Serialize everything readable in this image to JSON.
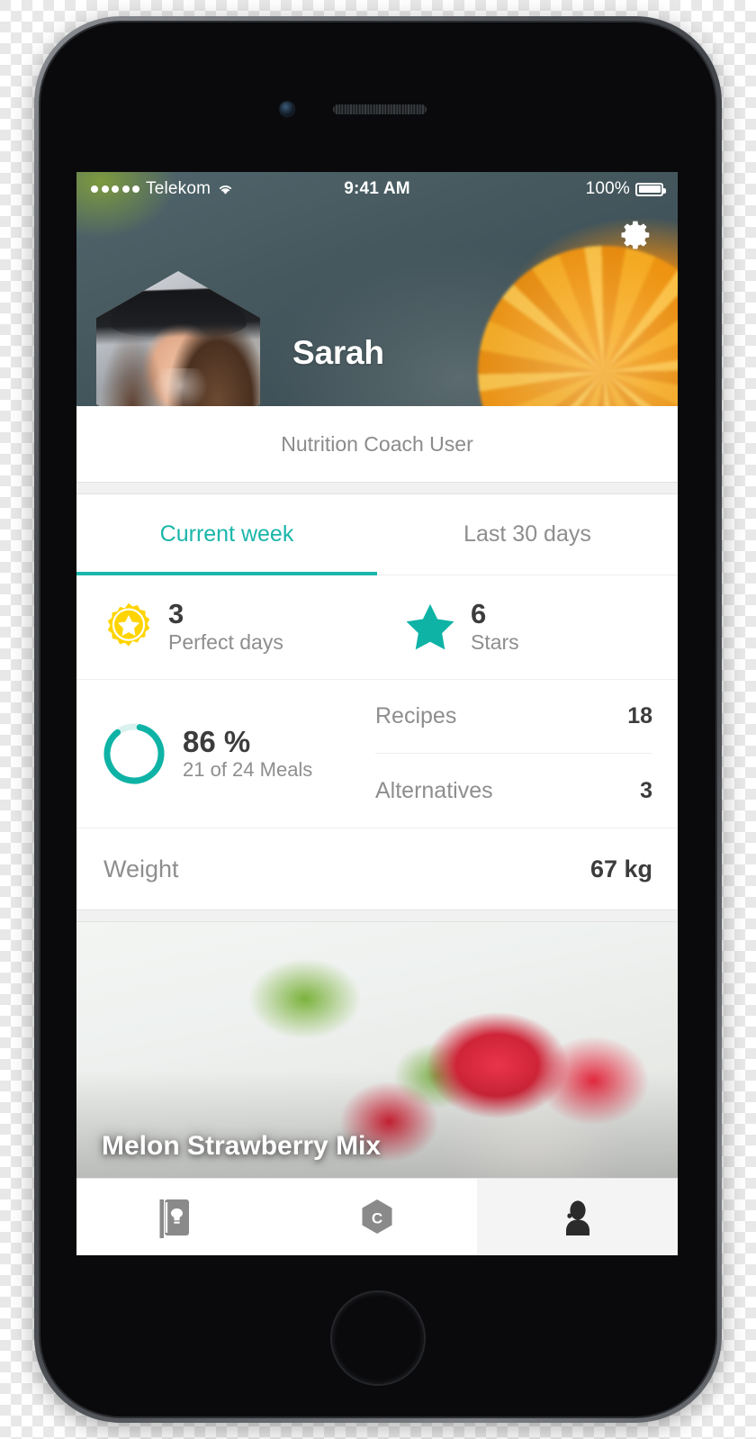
{
  "device": {
    "name": "iphone-mockup",
    "camera_icon": "front-camera",
    "earpiece_icon": "earpiece-speaker",
    "home_button_icon": "home-button"
  },
  "status_bar": {
    "carrier": "Telekom",
    "signal_dots": 5,
    "wifi_icon": "wifi-icon",
    "time": "9:41 AM",
    "battery_percent": "100%",
    "battery_icon": "battery-full-icon"
  },
  "header": {
    "settings_icon": "gear-icon",
    "avatar_name": "avatar",
    "user_name": "Sarah",
    "subtitle": "Nutrition Coach User"
  },
  "tabs": [
    {
      "label": "Current week",
      "active": true
    },
    {
      "label": "Last 30 days",
      "active": false
    }
  ],
  "stats": {
    "perfect_days": {
      "icon": "badge-star-icon",
      "value": "3",
      "label": "Perfect days"
    },
    "stars": {
      "icon": "star-icon",
      "value": "6",
      "label": "Stars"
    },
    "meals": {
      "icon": "progress-ring-icon",
      "percent_text": "86 %",
      "percent_value": 86,
      "sub_label": "21 of 24 Meals"
    },
    "kv": [
      {
        "key": "Recipes",
        "value": "18"
      },
      {
        "key": "Alternatives",
        "value": "3"
      }
    ],
    "weight": {
      "key": "Weight",
      "value": "67 kg"
    }
  },
  "recipe_card": {
    "title": "Melon Strawberry Mix",
    "image_name": "melon-strawberry-photo"
  },
  "bottom_nav": [
    {
      "name": "recipes",
      "icon": "recipe-book-icon",
      "active": false
    },
    {
      "name": "coach",
      "icon": "coach-hexagon-c-icon",
      "active": false
    },
    {
      "name": "profile",
      "icon": "person-icon",
      "active": true
    }
  ],
  "colors": {
    "accent_teal": "#1ab6aa",
    "accent_teal_light": "#d9f2ef",
    "badge_yellow": "#ffd400",
    "text_dark": "#3c3c3c",
    "text_muted": "#8e8e8e",
    "nav_icon_gray": "#8a8a8a",
    "nav_icon_active": "#2b2b2b"
  }
}
